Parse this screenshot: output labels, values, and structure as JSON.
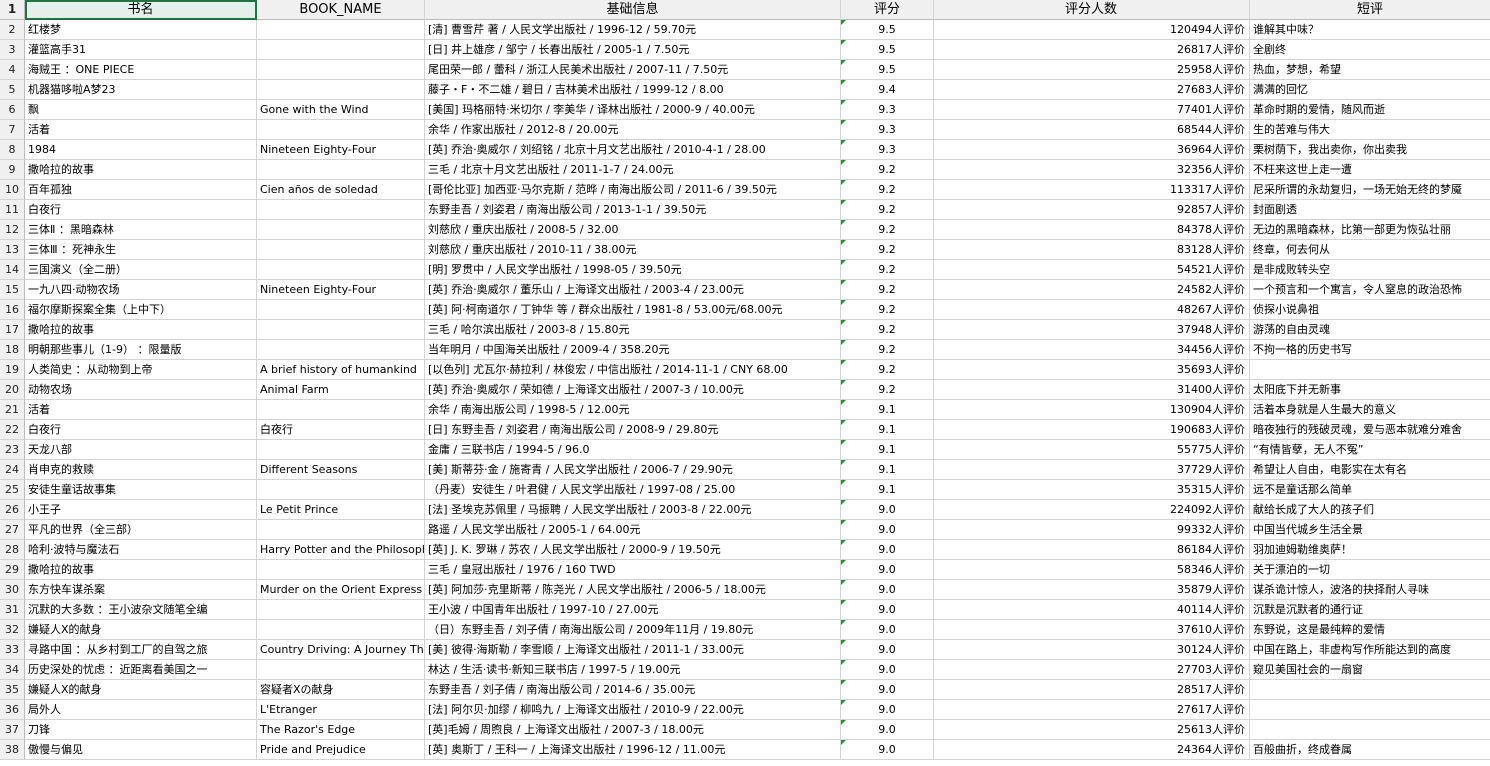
{
  "columns": {
    "row_header": "1",
    "title": "书名",
    "book_name": "BOOK_NAME",
    "info": "基础信息",
    "score": "评分",
    "ratings": "评分人数",
    "review": "短评"
  },
  "rows": [
    {
      "n": "2",
      "title": "红楼梦",
      "book_name": "",
      "info": "[清] 曹雪芹 著 / 人民文学出版社 / 1996-12 / 59.70元",
      "score": "9.5",
      "ratings": "120494人评价",
      "review": "谁解其中味？"
    },
    {
      "n": "3",
      "title": "灌篮高手31",
      "book_name": "",
      "info": "[日] 井上雄彦 / 邹宁 / 长春出版社 / 2005-1 / 7.50元",
      "score": "9.5",
      "ratings": "26817人评价",
      "review": "全剧终"
    },
    {
      "n": "4",
      "title": "海贼王  ：ONE PIECE",
      "book_name": "",
      "info": "尾田荣一郎 / 蕾科 / 浙江人民美术出版社 / 2007-11 / 7.50元",
      "score": "9.5",
      "ratings": "25958人评价",
      "review": "热血，梦想，希望"
    },
    {
      "n": "5",
      "title": "机器猫哆啦A梦23",
      "book_name": "",
      "info": "藤子・F・不二雄 / 碧日 / 吉林美术出版社 / 1999-12 / 8.00",
      "score": "9.4",
      "ratings": "27683人评价",
      "review": "满满的回忆"
    },
    {
      "n": "6",
      "title": "飘",
      "book_name": "Gone with the Wind",
      "info": "[美国] 玛格丽特·米切尔 / 李美华 / 译林出版社 / 2000-9 / 40.00元",
      "score": "9.3",
      "ratings": "77401人评价",
      "review": "革命时期的爱情，随风而逝"
    },
    {
      "n": "7",
      "title": "活着",
      "book_name": "",
      "info": "余华 / 作家出版社 / 2012-8 / 20.00元",
      "score": "9.3",
      "ratings": "68544人评价",
      "review": "生的苦难与伟大"
    },
    {
      "n": "8",
      "title": "1984",
      "book_name": "Nineteen Eighty-Four",
      "info": "[英] 乔治·奥威尔 / 刘绍铭 / 北京十月文艺出版社 / 2010-4-1 / 28.00",
      "score": "9.3",
      "ratings": "36964人评价",
      "review": "栗树荫下，我出卖你，你出卖我"
    },
    {
      "n": "9",
      "title": "撒哈拉的故事",
      "book_name": "",
      "info": "三毛 / 北京十月文艺出版社 / 2011-1-7 / 24.00元",
      "score": "9.2",
      "ratings": "32356人评价",
      "review": "不枉来这世上走一遭"
    },
    {
      "n": "10",
      "title": "百年孤独",
      "book_name": "Cien años de soledad",
      "info": "[哥伦比亚] 加西亚·马尔克斯 / 范晔 / 南海出版公司 / 2011-6 / 39.50元",
      "score": "9.2",
      "ratings": "113317人评价",
      "review": "尼采所谓的永劫复归，一场无始无终的梦魇"
    },
    {
      "n": "11",
      "title": "白夜行",
      "book_name": "",
      "info": "东野圭吾 / 刘姿君 / 南海出版公司 / 2013-1-1 / 39.50元",
      "score": "9.2",
      "ratings": "92857人评价",
      "review": "封面剧透"
    },
    {
      "n": "12",
      "title": "三体Ⅱ  ：黑暗森林",
      "book_name": "",
      "info": "刘慈欣 / 重庆出版社 / 2008-5 / 32.00",
      "score": "9.2",
      "ratings": "84378人评价",
      "review": "无边的黑暗森林，比第一部更为恢弘壮丽"
    },
    {
      "n": "13",
      "title": "三体Ⅲ  ：死神永生",
      "book_name": "",
      "info": "刘慈欣 / 重庆出版社 / 2010-11 / 38.00元",
      "score": "9.2",
      "ratings": "83128人评价",
      "review": "终章，何去何从"
    },
    {
      "n": "14",
      "title": "三国演义（全二册）",
      "book_name": "",
      "info": "[明] 罗贯中 / 人民文学出版社 / 1998-05 / 39.50元",
      "score": "9.2",
      "ratings": "54521人评价",
      "review": "是非成败转头空"
    },
    {
      "n": "15",
      "title": "一九八四·动物农场",
      "book_name": "Nineteen Eighty-Four",
      "info": "[英] 乔治·奥威尔 / 董乐山 / 上海译文出版社 / 2003-4 / 23.00元",
      "score": "9.2",
      "ratings": "24582人评价",
      "review": "一个预言和一个寓言，令人窒息的政治恐怖"
    },
    {
      "n": "16",
      "title": "福尔摩斯探案全集（上中下）",
      "book_name": "",
      "info": "[英] 阿·柯南道尔 / 丁钟华 等 / 群众出版社 / 1981-8 / 53.00元/68.00元",
      "score": "9.2",
      "ratings": "48267人评价",
      "review": "侦探小说鼻祖"
    },
    {
      "n": "17",
      "title": "撒哈拉的故事",
      "book_name": "",
      "info": "三毛 / 哈尔滨出版社 / 2003-8 / 15.80元",
      "score": "9.2",
      "ratings": "37948人评价",
      "review": "游荡的自由灵魂"
    },
    {
      "n": "18",
      "title": "明朝那些事儿（1-9）  ：限量版",
      "book_name": "",
      "info": "当年明月 / 中国海关出版社 / 2009-4 / 358.20元",
      "score": "9.2",
      "ratings": "34456人评价",
      "review": "不拘一格的历史书写"
    },
    {
      "n": "19",
      "title": "人类简史  ：从动物到上帝",
      "book_name": "A brief history of humankind",
      "info": "[以色列] 尤瓦尔·赫拉利 / 林俊宏 / 中信出版社 / 2014-11-1 / CNY 68.00",
      "score": "9.2",
      "ratings": "35693人评价",
      "review": ""
    },
    {
      "n": "20",
      "title": "动物农场",
      "book_name": "Animal Farm",
      "info": "[英] 乔治·奥威尔 / 荣如德 / 上海译文出版社 / 2007-3 / 10.00元",
      "score": "9.2",
      "ratings": "31400人评价",
      "review": "太阳底下并无新事"
    },
    {
      "n": "21",
      "title": "活着",
      "book_name": "",
      "info": "余华 / 南海出版公司 / 1998-5 / 12.00元",
      "score": "9.1",
      "ratings": "130904人评价",
      "review": "活着本身就是人生最大的意义"
    },
    {
      "n": "22",
      "title": "白夜行",
      "book_name": "白夜行",
      "info": "[日] 东野圭吾 / 刘姿君 / 南海出版公司 / 2008-9 / 29.80元",
      "score": "9.1",
      "ratings": "190683人评价",
      "review": "暗夜独行的残破灵魂，爱与恶本就难分难舍"
    },
    {
      "n": "23",
      "title": "天龙八部",
      "book_name": "",
      "info": "金庸 / 三联书店 / 1994-5 / 96.0",
      "score": "9.1",
      "ratings": "55775人评价",
      "review": "“有情皆孽，无人不冤”"
    },
    {
      "n": "24",
      "title": "肖申克的救赎",
      "book_name": "Different Seasons",
      "info": "[美] 斯蒂芬·金 / 施寄青 / 人民文学出版社 / 2006-7 / 29.90元",
      "score": "9.1",
      "ratings": "37729人评价",
      "review": "希望让人自由，电影实在太有名"
    },
    {
      "n": "25",
      "title": "安徒生童话故事集",
      "book_name": "",
      "info": "（丹麦）安徒生 / 叶君健 / 人民文学出版社 / 1997-08 / 25.00",
      "score": "9.1",
      "ratings": "35315人评价",
      "review": "远不是童话那么简单"
    },
    {
      "n": "26",
      "title": "小王子",
      "book_name": "Le Petit Prince",
      "info": "[法] 圣埃克苏佩里 / 马振聘 / 人民文学出版社 / 2003-8 / 22.00元",
      "score": "9.0",
      "ratings": "224092人评价",
      "review": "献给长成了大人的孩子们"
    },
    {
      "n": "27",
      "title": "平凡的世界（全三部）",
      "book_name": "",
      "info": "路遥 / 人民文学出版社 / 2005-1 / 64.00元",
      "score": "9.0",
      "ratings": "99332人评价",
      "review": "中国当代城乡生活全景"
    },
    {
      "n": "28",
      "title": "哈利·波特与魔法石",
      "book_name": "Harry Potter and the Philosoph",
      "info": "[英] J. K. 罗琳 / 苏农 / 人民文学出版社 / 2000-9 / 19.50元",
      "score": "9.0",
      "ratings": "86184人评价",
      "review": "羽加迪姆勒维奥萨！"
    },
    {
      "n": "29",
      "title": "撒哈拉的故事",
      "book_name": "",
      "info": "三毛 / 皇冠出版社 / 1976 / 160 TWD",
      "score": "9.0",
      "ratings": "58346人评价",
      "review": "关于漂泊的一切"
    },
    {
      "n": "30",
      "title": "东方快车谋杀案",
      "book_name": "Murder on the Orient Express",
      "info": "[英] 阿加莎·克里斯蒂 / 陈尧光 / 人民文学出版社 / 2006-5 / 18.00元",
      "score": "9.0",
      "ratings": "35879人评价",
      "review": "谋杀诡计惊人，波洛的抉择耐人寻味"
    },
    {
      "n": "31",
      "title": "沉默的大多数  ：王小波杂文随笔全编",
      "book_name": "",
      "info": "王小波 / 中国青年出版社 / 1997-10 / 27.00元",
      "score": "9.0",
      "ratings": "40114人评价",
      "review": "沉默是沉默者的通行证"
    },
    {
      "n": "32",
      "title": "嫌疑人X的献身",
      "book_name": "",
      "info": "（日）东野圭吾 / 刘子倩 / 南海出版公司 / 2009年11月 / 19.80元",
      "score": "9.0",
      "ratings": "37610人评价",
      "review": "东野说，这是最纯粹的爱情"
    },
    {
      "n": "33",
      "title": "寻路中国  ：从乡村到工厂的自驾之旅",
      "book_name": "Country Driving: A Journey Through",
      "info": "[美] 彼得·海斯勒 / 李雪顺 / 上海译文出版社 / 2011-1 / 33.00元",
      "score": "9.0",
      "ratings": "30124人评价",
      "review": "中国在路上，非虚构写作所能达到的高度"
    },
    {
      "n": "34",
      "title": "历史深处的忧虑  ：近距离看美国之一",
      "book_name": "",
      "info": "林达 / 生活·读书·新知三联书店 / 1997-5 / 19.00元",
      "score": "9.0",
      "ratings": "27703人评价",
      "review": "窥见美国社会的一扇窗"
    },
    {
      "n": "35",
      "title": "嫌疑人X的献身",
      "book_name": "容疑者Xの献身",
      "info": "东野圭吾 / 刘子倩 / 南海出版公司 / 2014-6 / 35.00元",
      "score": "9.0",
      "ratings": "28517人评价",
      "review": ""
    },
    {
      "n": "36",
      "title": "局外人",
      "book_name": "L'Etranger",
      "info": "[法] 阿尔贝·加缪 / 柳鸣九 / 上海译文出版社 / 2010-9 / 22.00元",
      "score": "9.0",
      "ratings": "27617人评价",
      "review": ""
    },
    {
      "n": "37",
      "title": "刀锋",
      "book_name": "The Razor's Edge",
      "info": "[英]毛姆 / 周煦良 / 上海译文出版社 / 2007-3 / 18.00元",
      "score": "9.0",
      "ratings": "25613人评价",
      "review": ""
    },
    {
      "n": "38",
      "title": "傲慢与偏见",
      "book_name": "Pride and Prejudice",
      "info": "[英] 奥斯丁 / 王科一 / 上海译文出版社 / 1996-12 / 11.00元",
      "score": "9.0",
      "ratings": "24364人评价",
      "review": "百般曲折，终成眷属"
    }
  ]
}
